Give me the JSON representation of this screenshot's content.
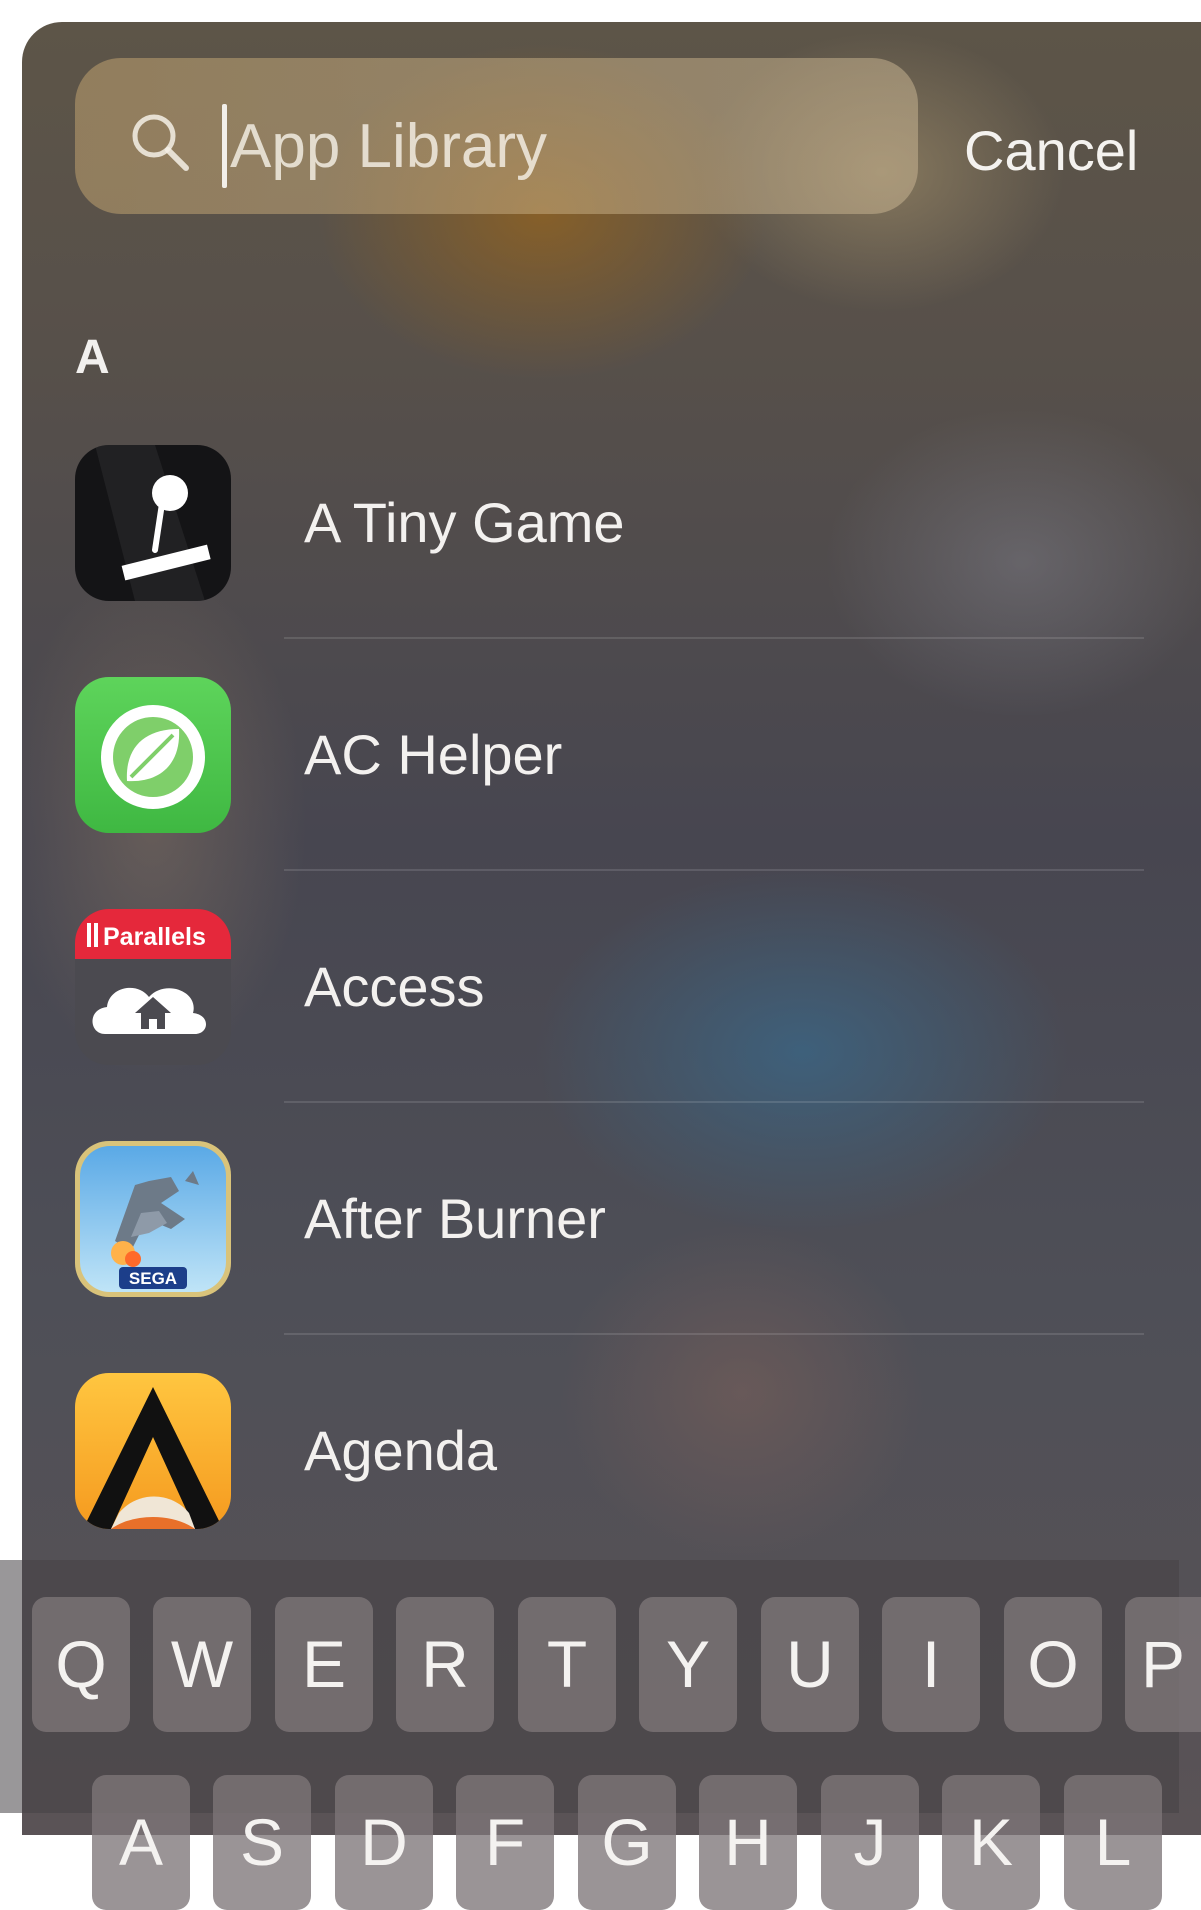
{
  "search": {
    "placeholder": "App Library",
    "cancel_label": "Cancel"
  },
  "section": {
    "header": "A"
  },
  "apps": [
    {
      "name": "A Tiny Game",
      "icon": "tiny-game-icon"
    },
    {
      "name": "AC Helper",
      "icon": "leaf-icon"
    },
    {
      "name": "Access",
      "icon": "parallels-access-icon",
      "icon_banner_text": "Parallels"
    },
    {
      "name": "After Burner",
      "icon": "jet-fighter-icon",
      "icon_badge_text": "SEGA"
    },
    {
      "name": "Agenda",
      "icon": "agenda-a-icon"
    }
  ],
  "keyboard": {
    "row1": [
      "Q",
      "W",
      "E",
      "R",
      "T",
      "Y",
      "U",
      "I",
      "O",
      "P"
    ],
    "row2": [
      "A",
      "S",
      "D",
      "F",
      "G",
      "H",
      "J",
      "K",
      "L"
    ]
  },
  "colors": {
    "ac_helper_green": "#4cc44a",
    "parallels_red": "#e5283b",
    "agenda_orange": "#f5a623"
  }
}
